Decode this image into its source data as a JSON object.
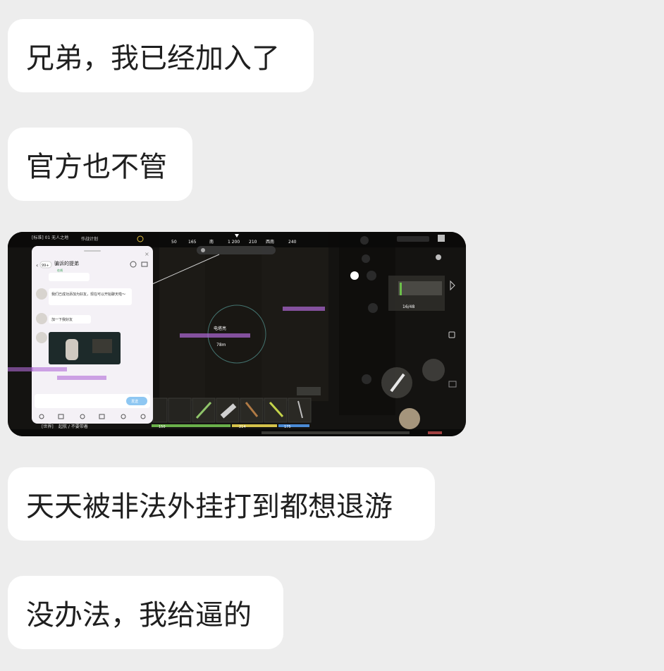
{
  "messages": [
    {
      "kind": "text",
      "text": "兄弟，我已经加入了"
    },
    {
      "kind": "text",
      "text": "官方也不管"
    },
    {
      "kind": "image"
    },
    {
      "kind": "text",
      "text": "天天被非法外挂打到都想退游"
    },
    {
      "kind": "text",
      "text": "没办法，我给逼的"
    }
  ],
  "screenshot": {
    "hud": {
      "server": "[标准] 01 无人之地",
      "task": "作战计划",
      "compass": [
        "50",
        "165",
        "南",
        "1 200",
        "210",
        "西南",
        "240"
      ],
      "distance": "78m",
      "area": "电塔亮",
      "weapon_ammo": "16/48",
      "health": "150",
      "stamina": "214",
      "food": "175",
      "chat_channel": "[世界]",
      "chat_text": "起航 / 不要带着"
    },
    "chat_window": {
      "title": "骗诉的提弟",
      "badge": "99+",
      "status": "在线",
      "msg1": "我们已成功添加为好友，现在可以开始聊天啦～",
      "msg2": "加一下我好友",
      "send": "发送"
    }
  }
}
